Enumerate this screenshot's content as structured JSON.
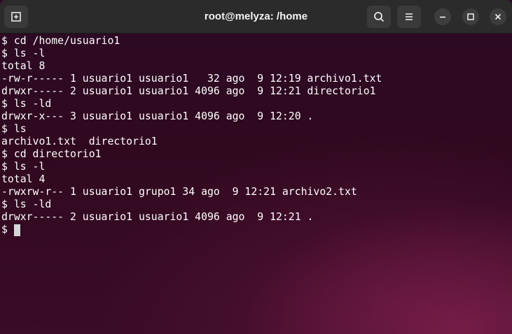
{
  "window": {
    "title": "root@melyza: /home"
  },
  "toolbar": {
    "new_tab_icon": "new-tab-icon",
    "search_icon": "search-icon",
    "menu_icon": "hamburger-menu-icon",
    "minimize_icon": "minimize-icon",
    "maximize_icon": "maximize-icon",
    "close_icon": "close-icon"
  },
  "terminal": {
    "lines": [
      "$ cd /home/usuario1",
      "$ ls -l",
      "total 8",
      "-rw-r----- 1 usuario1 usuario1   32 ago  9 12:19 archivo1.txt",
      "drwxr----- 2 usuario1 usuario1 4096 ago  9 12:21 directorio1",
      "$ ls -ld",
      "drwxr-x--- 3 usuario1 usuario1 4096 ago  9 12:20 .",
      "$ ls",
      "archivo1.txt  directorio1",
      "$ cd directorio1",
      "$ ls -l",
      "total 4",
      "-rwxrw-r-- 1 usuario1 grupo1 34 ago  9 12:21 archivo2.txt",
      "$ ls -ld",
      "drwxr----- 2 usuario1 usuario1 4096 ago  9 12:21 ."
    ],
    "prompt": "$"
  },
  "colors": {
    "titlebar": "#2b2b2b",
    "terminal_bg": "#300a24",
    "text": "#ffffff",
    "cursor": "#d6d6d6"
  }
}
